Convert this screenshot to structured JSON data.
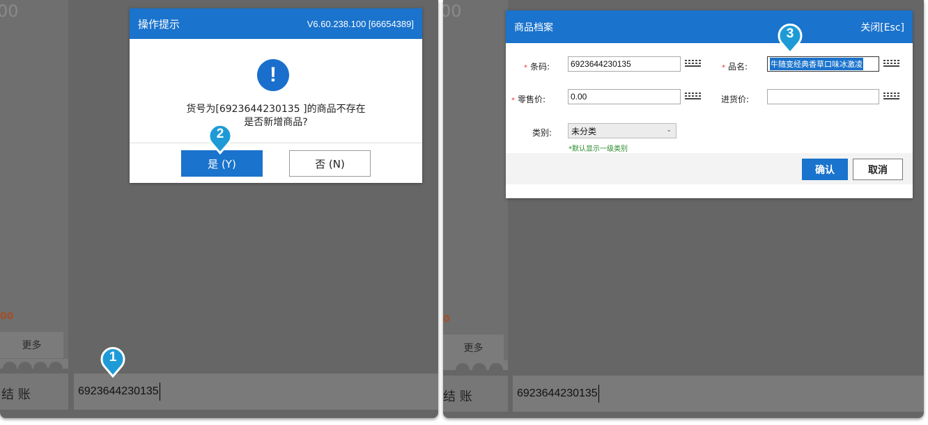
{
  "left": {
    "sidebar_top_value": "00",
    "sidebar_amount": "00",
    "more_label": "更多",
    "checkout_label": "结 账",
    "barcode_input": "6923644230135"
  },
  "prompt_dialog": {
    "title": "操作提示",
    "version": "V6.60.238.100 [66654389]",
    "message_line1": "货号为[6923644230135 ]的商品不存在",
    "message_line2": "是否新增商品?",
    "yes_label": "是 (Y)",
    "no_label": "否 (N)",
    "icon": "exclamation-icon"
  },
  "right": {
    "sidebar_top_value": "00",
    "sidebar_amount": "0",
    "more_label": "更多",
    "checkout_label": "结 账",
    "barcode_input": "6923644230135"
  },
  "product_dialog": {
    "title": "商品档案",
    "close_label": "关闭[Esc]",
    "barcode_label": "条码:",
    "barcode_value": "6923644230135",
    "name_label": "品名:",
    "name_value": "牛随变经典香草口味冰激凌",
    "retail_price_label": "零售价:",
    "retail_price_value": "0.00",
    "purchase_price_label": "进货价:",
    "purchase_price_value": "",
    "category_label": "类别:",
    "category_value": "未分类",
    "category_hint": "*默认显示一级类别",
    "confirm_label": "确认",
    "cancel_label": "取消"
  },
  "markers": [
    "1",
    "2",
    "3"
  ],
  "colors": {
    "accent": "#1a73cc",
    "marker": "#1e9bd7",
    "overlay": "#666666"
  }
}
